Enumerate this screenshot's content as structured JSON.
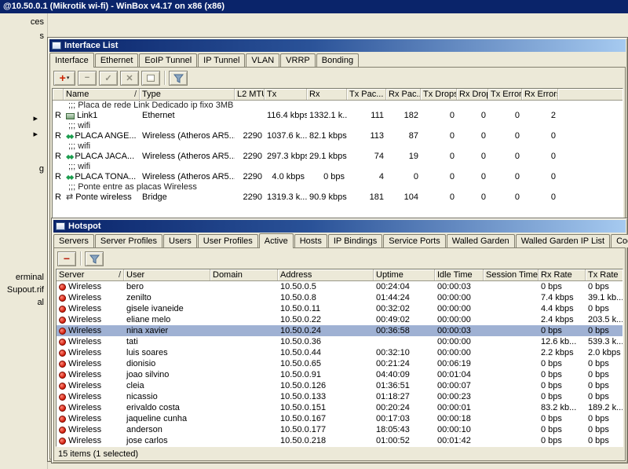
{
  "app": {
    "title": "@10.50.0.1 (Mikrotik wi-fi) - WinBox v4.17 on x86 (x86)"
  },
  "colors": {
    "title_bar": "#0a246a",
    "title_gradient_end": "#a6caf0",
    "window_face": "#ece9d8",
    "selected_row": "#9fb1d3",
    "add_accent": "#cc2200"
  },
  "sidebar": {
    "fragments": [
      "ces",
      "s",
      "▸",
      "▸",
      "g",
      "erminal",
      "Supout.rif",
      "al"
    ]
  },
  "interface_list": {
    "title": "Interface List",
    "tabs": [
      {
        "label": "Interface",
        "active": true
      },
      {
        "label": "Ethernet"
      },
      {
        "label": "EoIP Tunnel"
      },
      {
        "label": "IP Tunnel"
      },
      {
        "label": "VLAN"
      },
      {
        "label": "VRRP"
      },
      {
        "label": "Bonding"
      }
    ],
    "toolbar": {
      "add": "+",
      "caret": "▾",
      "remove": "−",
      "enable": "✓",
      "disable": "✕"
    },
    "columns": {
      "name": "Name",
      "sort": "/",
      "type": "Type",
      "l2mtu": "L2 MTU",
      "tx": "Tx",
      "rx": "Rx",
      "txp": "Tx Pac...",
      "rxp": "Rx Pac...",
      "txd": "Tx Drops",
      "rxd": "Rx Drops",
      "txe": "Tx Errors",
      "rxe": "Rx Errors"
    },
    "rows": [
      {
        "comment": true,
        "name": ";;; Placa de rede Link Dedicado ip fixo 3MB"
      },
      {
        "flag": "R",
        "icon": "eth",
        "name": "Link1",
        "type": "Ethernet",
        "l2mtu": "",
        "tx": "116.4 kbps",
        "rx": "1332.1 k...",
        "txp": "111",
        "rxp": "182",
        "txd": "0",
        "rxd": "0",
        "txe": "0",
        "rxe": "2"
      },
      {
        "comment": true,
        "name": ";;; wifi"
      },
      {
        "flag": "R",
        "icon": "wifi",
        "name": "PLACA ANGE...",
        "type": "Wireless (Atheros AR5...",
        "l2mtu": "2290",
        "tx": "1037.6 k...",
        "rx": "82.1 kbps",
        "txp": "113",
        "rxp": "87",
        "txd": "0",
        "rxd": "0",
        "txe": "0",
        "rxe": "0"
      },
      {
        "comment": true,
        "name": ";;; wifi"
      },
      {
        "flag": "R",
        "icon": "wifi",
        "name": "PLACA JACA...",
        "type": "Wireless (Atheros AR5...",
        "l2mtu": "2290",
        "tx": "297.3 kbps",
        "rx": "29.1 kbps",
        "txp": "74",
        "rxp": "19",
        "txd": "0",
        "rxd": "0",
        "txe": "0",
        "rxe": "0"
      },
      {
        "comment": true,
        "name": ";;; wifi"
      },
      {
        "flag": "R",
        "icon": "wifi",
        "name": "PLACA TONA...",
        "type": "Wireless (Atheros AR5...",
        "l2mtu": "2290",
        "tx": "4.0 kbps",
        "rx": "0 bps",
        "txp": "4",
        "rxp": "0",
        "txd": "0",
        "rxd": "0",
        "txe": "0",
        "rxe": "0"
      },
      {
        "comment": true,
        "name": ";;; Ponte entre as placas Wireless"
      },
      {
        "flag": "R",
        "icon": "bridge",
        "name": "Ponte wireless",
        "type": "Bridge",
        "l2mtu": "2290",
        "tx": "1319.3 k...",
        "rx": "90.9 kbps",
        "txp": "181",
        "rxp": "104",
        "txd": "0",
        "rxd": "0",
        "txe": "0",
        "rxe": "0"
      }
    ]
  },
  "hotspot": {
    "title": "Hotspot",
    "tabs": [
      {
        "label": "Servers"
      },
      {
        "label": "Server Profiles"
      },
      {
        "label": "Users"
      },
      {
        "label": "User Profiles"
      },
      {
        "label": "Active",
        "active": true
      },
      {
        "label": "Hosts"
      },
      {
        "label": "IP Bindings"
      },
      {
        "label": "Service Ports"
      },
      {
        "label": "Walled Garden"
      },
      {
        "label": "Walled Garden IP List"
      },
      {
        "label": "Cookies"
      }
    ],
    "toolbar": {
      "remove": "−"
    },
    "columns": {
      "server": "Server",
      "sort": "/",
      "user": "User",
      "domain": "Domain",
      "address": "Address",
      "uptime": "Uptime",
      "idle": "Idle Time",
      "session": "Session Time...",
      "rx": "Rx Rate",
      "tx": "Tx Rate"
    },
    "rows": [
      {
        "server": "Wireless",
        "user": "bero",
        "domain": "",
        "address": "10.50.0.5",
        "uptime": "00:24:04",
        "idle": "00:00:03",
        "session": "",
        "rx": "0 bps",
        "tx": "0 bps"
      },
      {
        "server": "Wireless",
        "user": "zenilto",
        "domain": "",
        "address": "10.50.0.8",
        "uptime": "01:44:24",
        "idle": "00:00:00",
        "session": "",
        "rx": "7.4 kbps",
        "tx": "39.1 kb..."
      },
      {
        "server": "Wireless",
        "user": "gisele ivaneide",
        "domain": "",
        "address": "10.50.0.11",
        "uptime": "00:32:02",
        "idle": "00:00:00",
        "session": "",
        "rx": "4.4 kbps",
        "tx": "0 bps"
      },
      {
        "server": "Wireless",
        "user": "eliane melo",
        "domain": "",
        "address": "10.50.0.22",
        "uptime": "00:49:02",
        "idle": "00:00:00",
        "session": "",
        "rx": "2.4 kbps",
        "tx": "203.5 k..."
      },
      {
        "server": "Wireless",
        "user": "nina xavier",
        "domain": "",
        "address": "10.50.0.24",
        "uptime": "00:36:58",
        "idle": "00:00:03",
        "session": "",
        "rx": "0 bps",
        "tx": "0 bps",
        "selected": true
      },
      {
        "server": "Wireless",
        "user": "tati",
        "domain": "",
        "address": "10.50.0.36",
        "uptime": "",
        "idle": "00:00:00",
        "session": "",
        "rx": "12.6 kb...",
        "tx": "539.3 k..."
      },
      {
        "server": "Wireless",
        "user": "luis soares",
        "domain": "",
        "address": "10.50.0.44",
        "uptime": "00:32:10",
        "idle": "00:00:00",
        "session": "",
        "rx": "2.2 kbps",
        "tx": "2.0 kbps"
      },
      {
        "server": "Wireless",
        "user": "dionisio",
        "domain": "",
        "address": "10.50.0.65",
        "uptime": "00:21:24",
        "idle": "00:06:19",
        "session": "",
        "rx": "0 bps",
        "tx": "0 bps"
      },
      {
        "server": "Wireless",
        "user": "joao silvino",
        "domain": "",
        "address": "10.50.0.91",
        "uptime": "04:40:09",
        "idle": "00:01:04",
        "session": "",
        "rx": "0 bps",
        "tx": "0 bps"
      },
      {
        "server": "Wireless",
        "user": "cleia",
        "domain": "",
        "address": "10.50.0.126",
        "uptime": "01:36:51",
        "idle": "00:00:07",
        "session": "",
        "rx": "0 bps",
        "tx": "0 bps"
      },
      {
        "server": "Wireless",
        "user": "nicassio",
        "domain": "",
        "address": "10.50.0.133",
        "uptime": "01:18:27",
        "idle": "00:00:23",
        "session": "",
        "rx": "0 bps",
        "tx": "0 bps"
      },
      {
        "server": "Wireless",
        "user": "erivaldo costa",
        "domain": "",
        "address": "10.50.0.151",
        "uptime": "00:20:24",
        "idle": "00:00:01",
        "session": "",
        "rx": "83.2 kb...",
        "tx": "189.2 k..."
      },
      {
        "server": "Wireless",
        "user": "jaqueline cunha",
        "domain": "",
        "address": "10.50.0.167",
        "uptime": "00:17:03",
        "idle": "00:00:18",
        "session": "",
        "rx": "0 bps",
        "tx": "0 bps"
      },
      {
        "server": "Wireless",
        "user": "anderson",
        "domain": "",
        "address": "10.50.0.177",
        "uptime": "18:05:43",
        "idle": "00:00:10",
        "session": "",
        "rx": "0 bps",
        "tx": "0 bps"
      },
      {
        "server": "Wireless",
        "user": "jose carlos",
        "domain": "",
        "address": "10.50.0.218",
        "uptime": "01:00:52",
        "idle": "00:01:42",
        "session": "",
        "rx": "0 bps",
        "tx": "0 bps"
      }
    ],
    "status": "15 items (1 selected)"
  }
}
